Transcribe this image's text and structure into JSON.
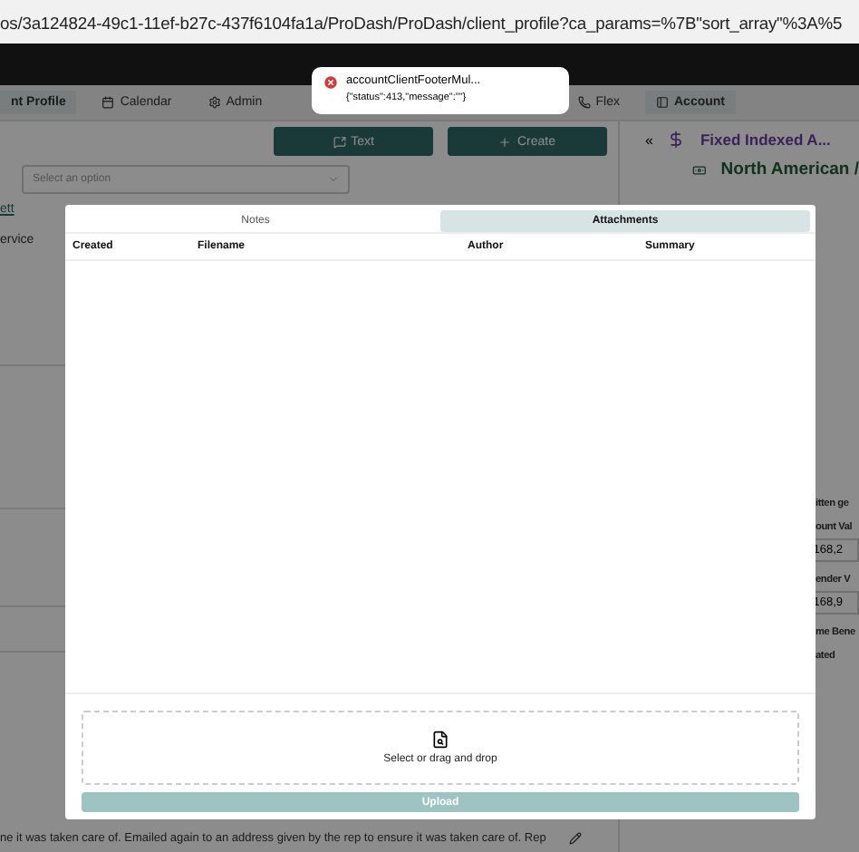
{
  "address_bar": {
    "url": "os/3a124824-49c1-11ef-b27c-437f6104fa1a/ProDash/ProDash/client_profile?ca_params=%7B\"sort_array\"%3A%5"
  },
  "nav": {
    "items": [
      {
        "label": "nt Profile",
        "selected": true
      },
      {
        "label": "Calendar",
        "selected": false
      },
      {
        "label": "Admin",
        "selected": false
      }
    ],
    "right_items": [
      {
        "label": "Flex",
        "selected": false
      },
      {
        "label": "Account",
        "selected": true
      }
    ]
  },
  "toolbar": {
    "buttons": [
      {
        "label": "Text"
      },
      {
        "label": "Create"
      }
    ]
  },
  "left": {
    "select": {
      "placeholder": "Select an option"
    },
    "link": "ett",
    "label": "ervice",
    "note": "ne it was taken care of.  Emailed again to an address given by the rep to ensure it was taken care of.  Rep"
  },
  "right_panel": {
    "collapse": "«",
    "product": "Fixed Indexed A...",
    "company": "North American /",
    "fields": [
      {
        "label": "itten ge"
      },
      {
        "label": "ount Val",
        "value": "168,2"
      },
      {
        "label": "ender V",
        "value": "168,9"
      },
      {
        "label": "me Bene"
      },
      {
        "label": "ated"
      }
    ]
  },
  "toast": {
    "title": "accountClientFooterMul...",
    "message": "{\"status\":413,\"message\":\"\"}"
  },
  "modal": {
    "tabs": [
      {
        "label": "Notes",
        "selected": false
      },
      {
        "label": "Attachments",
        "selected": true
      }
    ],
    "table": {
      "columns": [
        "Created",
        "Filename",
        "Author",
        "Summary"
      ]
    },
    "dropzone": {
      "label": "Select or drag and drop"
    },
    "upload": {
      "label": "Upload",
      "disabled": true
    }
  }
}
